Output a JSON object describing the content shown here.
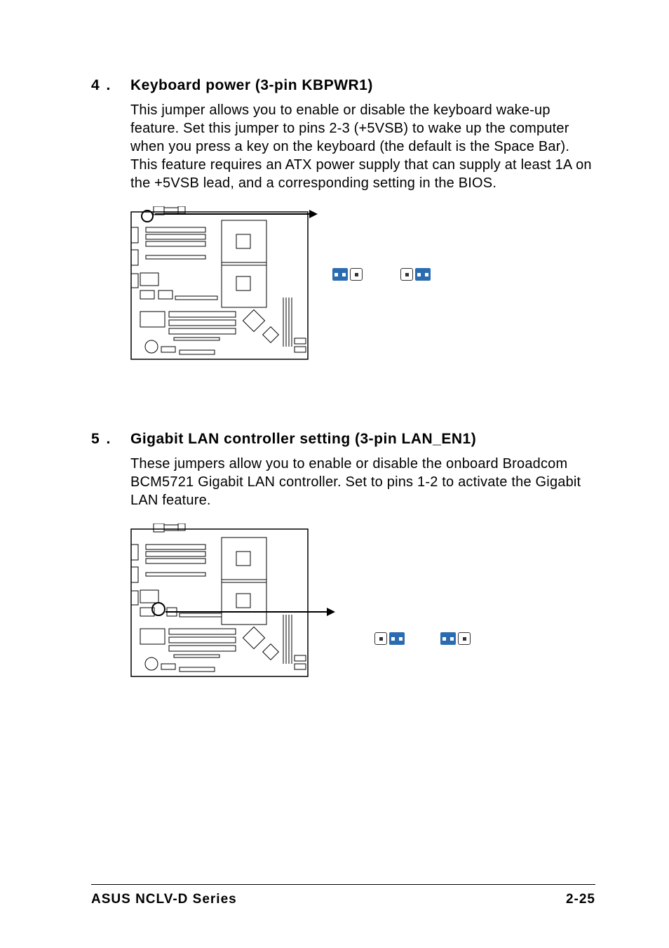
{
  "sections": [
    {
      "num": "4 .",
      "title": "Keyboard power (3-pin KBPWR1)",
      "body": "This jumper allows you to enable or disable the keyboard wake-up feature. Set this jumper to pins 2-3 (+5VSB) to wake up the computer when you press a key on the keyboard (the default is the Space Bar). This feature requires an ATX power supply that can supply at least 1A on the +5VSB lead, and a corresponding setting in the BIOS."
    },
    {
      "num": "5 .",
      "title": "Gigabit LAN controller setting (3-pin LAN_EN1)",
      "body": "These jumpers allow you to enable or disable the onboard Broadcom BCM5721 Gigabit LAN controller. Set to pins 1-2 to activate the Gigabit LAN feature."
    }
  ],
  "footer": {
    "left": "ASUS NCLV-D Series",
    "right": "2-25"
  }
}
